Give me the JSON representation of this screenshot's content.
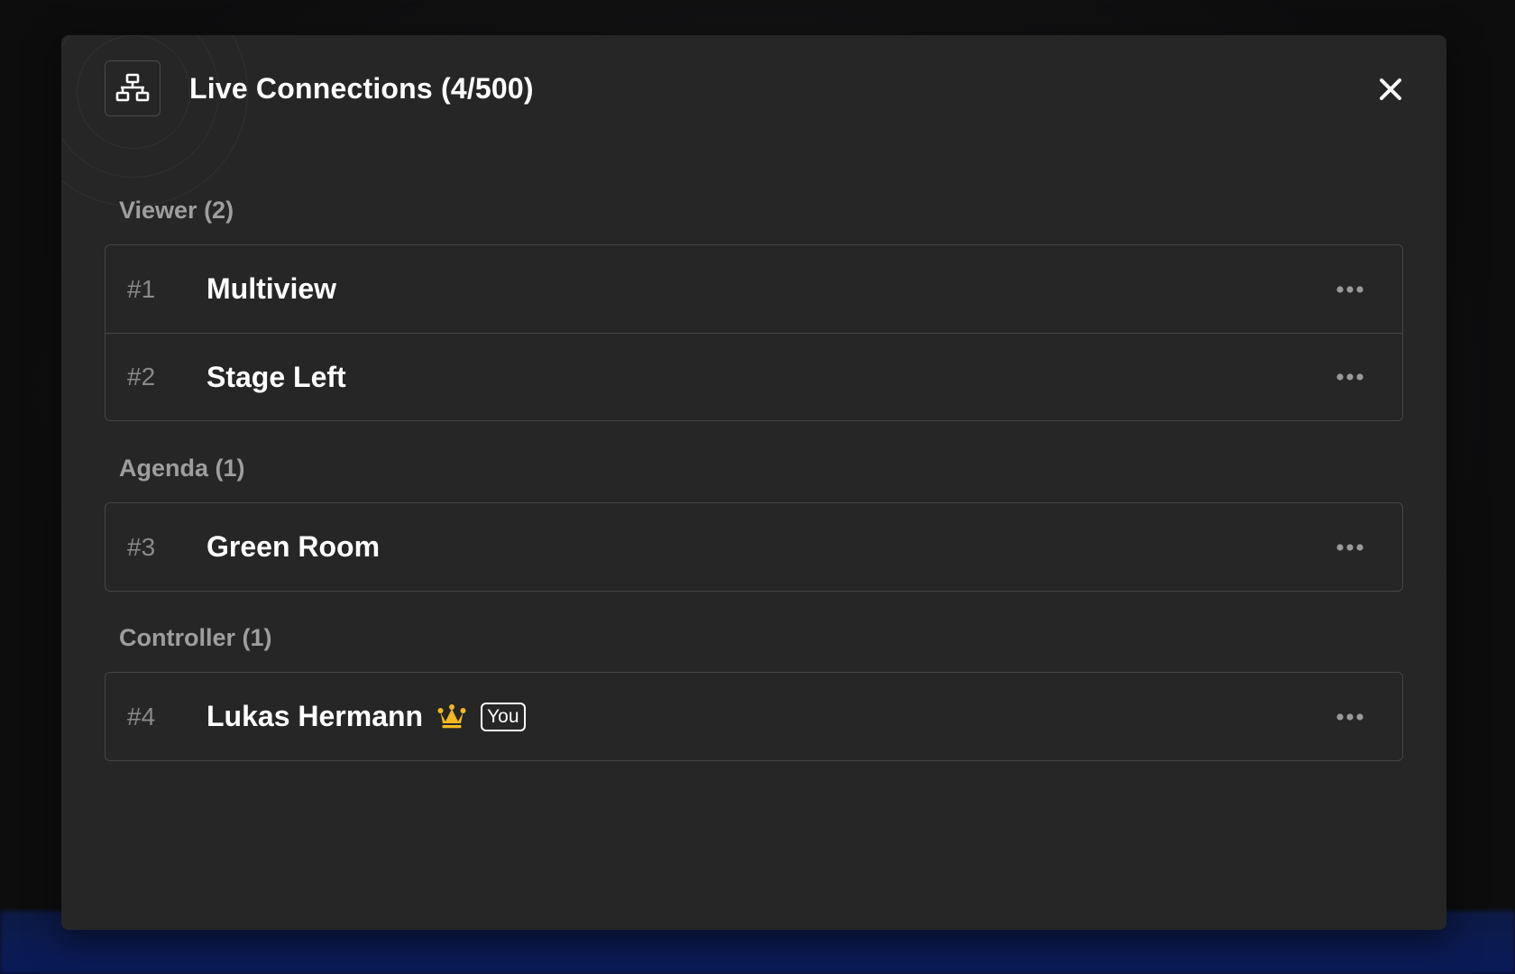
{
  "modal": {
    "title": "Live Connections (4/500)"
  },
  "groups": [
    {
      "label": "Viewer (2)",
      "items": [
        {
          "num": "#1",
          "name": "Multiview"
        },
        {
          "num": "#2",
          "name": "Stage Left"
        }
      ]
    },
    {
      "label": "Agenda (1)",
      "items": [
        {
          "num": "#3",
          "name": "Green Room"
        }
      ]
    },
    {
      "label": "Controller (1)",
      "items": [
        {
          "num": "#4",
          "name": "Lukas Hermann",
          "badge": "You",
          "icon": "crown-icon"
        }
      ]
    }
  ],
  "colors": {
    "modal_bg": "#262626",
    "crown": "#f2b91f",
    "muted_text": "#9e9e9e"
  },
  "icons": {
    "header": "network-icon",
    "close": "close-icon",
    "more": "more-horizontal-icon"
  }
}
